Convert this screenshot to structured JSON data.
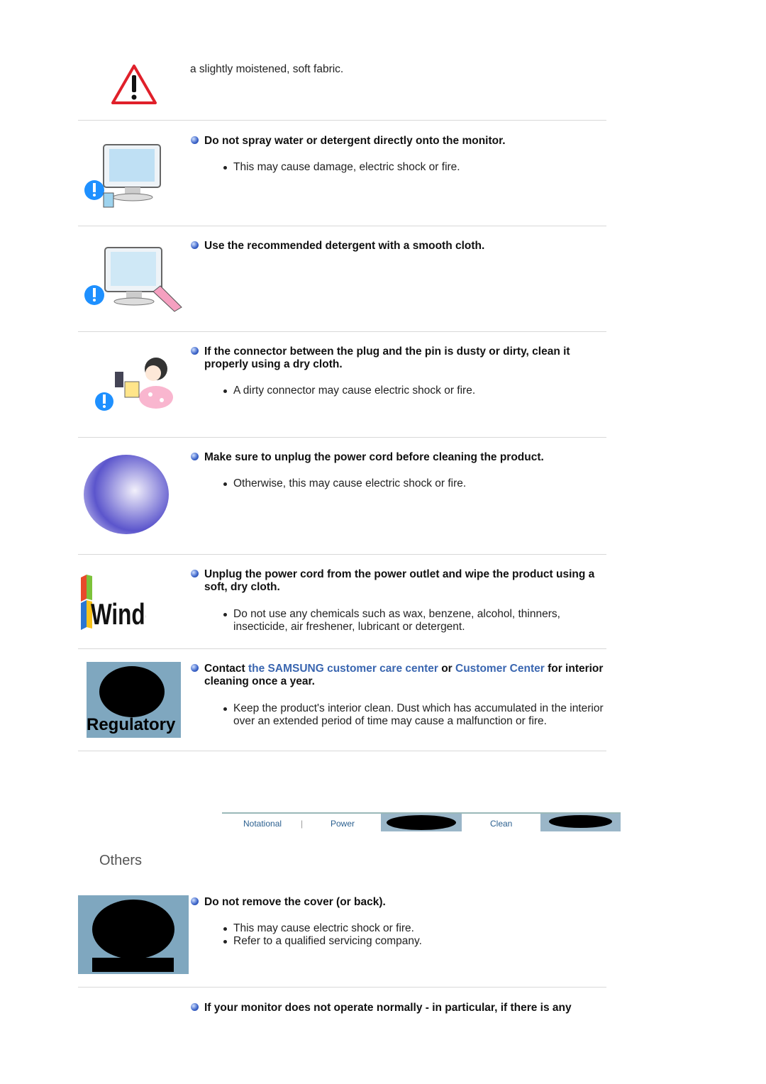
{
  "rows": [
    {
      "text": "a slightly moistened, soft fabric.",
      "icon": "warning-triangle-icon"
    },
    {
      "title": "Do not spray water or detergent directly onto the monitor.",
      "bullets": [
        "This may cause damage, electric shock or fire."
      ],
      "image": "spray-monitor-illustration"
    },
    {
      "title": "Use the recommended detergent with a smooth cloth.",
      "bullets": [],
      "image": "wipe-monitor-illustration"
    },
    {
      "title": "If the connector between the plug and the pin is dusty or dirty, clean it properly using a dry cloth.",
      "bullets": [
        "A dirty connector may cause electric shock or fire."
      ],
      "image": "clean-plug-illustration"
    },
    {
      "title": "Make sure to unplug the power cord before cleaning the product.",
      "bullets": [
        "Otherwise, this may cause electric shock or fire."
      ],
      "image": "sphere-image"
    },
    {
      "title": "Unplug the power cord from the power outlet and wipe the product using a soft, dry cloth.",
      "bullets": [
        "Do not use any chemicals such as wax, benzene, alcohol, thinners, insecticide, air freshener, lubricant or detergent."
      ],
      "image": "windows-logo"
    },
    {
      "title_parts": [
        "Contact ",
        "the SAMSUNG customer care center",
        " or ",
        "Customer Center",
        " for interior cleaning once a year."
      ],
      "bullets": [
        "Keep the product's interior clean. Dust which has accumulated in the interior over an extended period of time may cause a malfunction or fire."
      ],
      "image": "regulatory-image"
    }
  ],
  "nav": {
    "items": [
      "Notational",
      "Power",
      "Clean"
    ]
  },
  "others": {
    "heading": "Others",
    "rows": [
      {
        "title": "Do not remove the cover (or back).",
        "bullets": [
          "This may cause electric shock or fire.",
          "Refer to a qualified servicing company."
        ],
        "image": "regulatory-image"
      },
      {
        "title": "If your monitor does not operate normally - in particular, if there is any",
        "bullets": []
      }
    ]
  },
  "colors": {
    "link": "#3a66b0",
    "separator": "#d8d8d8"
  }
}
